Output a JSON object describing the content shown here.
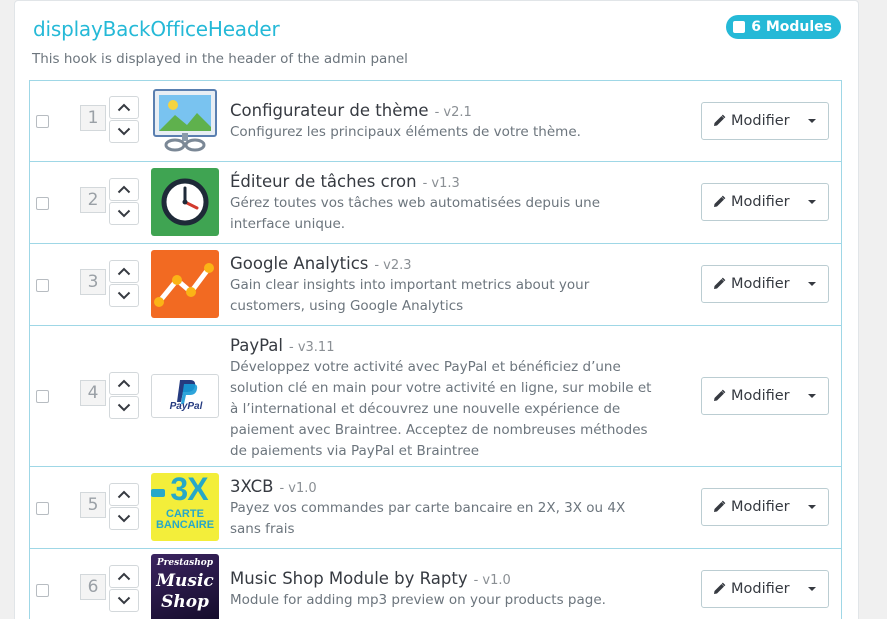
{
  "hook": {
    "title": "displayBackOfficeHeader",
    "description": "This hook is displayed in the header of the admin panel",
    "badge_label": "6 Modules"
  },
  "modules": [
    {
      "position": "1",
      "name": "Configurateur de thème",
      "version": "- v2.1",
      "description": "Configurez les principaux éléments de votre thème.",
      "action": "Modifier",
      "logo_icon": "theme-configurator-icon"
    },
    {
      "position": "2",
      "name": "Éditeur de tâches cron",
      "version": "- v1.3",
      "description": "Gérez toutes vos tâches web automatisées depuis une interface unique.",
      "action": "Modifier",
      "logo_icon": "cron-clock-icon"
    },
    {
      "position": "3",
      "name": "Google Analytics",
      "version": "- v2.3",
      "description": "Gain clear insights into important metrics about your customers, using Google Analytics",
      "action": "Modifier",
      "logo_icon": "google-analytics-icon"
    },
    {
      "position": "4",
      "name": "PayPal",
      "version": "- v3.11",
      "description": "Développez votre activité avec PayPal et bénéficiez d’une solution clé en main pour votre activité en ligne, sur mobile et à l’international et découvrez une nouvelle expérience de paiement avec Braintree. Acceptez de nombreuses méthodes de paiements via PayPal et Braintree",
      "action": "Modifier",
      "logo_icon": "paypal-icon",
      "logo_text": "PayPal"
    },
    {
      "position": "5",
      "name": "3XCB",
      "version": "- v1.0",
      "description": "Payez vos commandes par carte bancaire en 2X, 3X ou 4X sans frais",
      "action": "Modifier",
      "logo_icon": "3xcb-card-icon",
      "logo_text": "3X",
      "logo_sub": "CARTE BANCAIRE"
    },
    {
      "position": "6",
      "name": "Music Shop Module by Rapty",
      "version": "- v1.0",
      "description": "Module for adding mp3 preview on your products page.",
      "action": "Modifier",
      "logo_icon": "music-shop-icon",
      "logo_top": "Prestashop",
      "logo_line1": "Music",
      "logo_line2": "Shop"
    }
  ],
  "colors": {
    "accent": "#25b9d7",
    "row_border": "#9fd7e6"
  }
}
